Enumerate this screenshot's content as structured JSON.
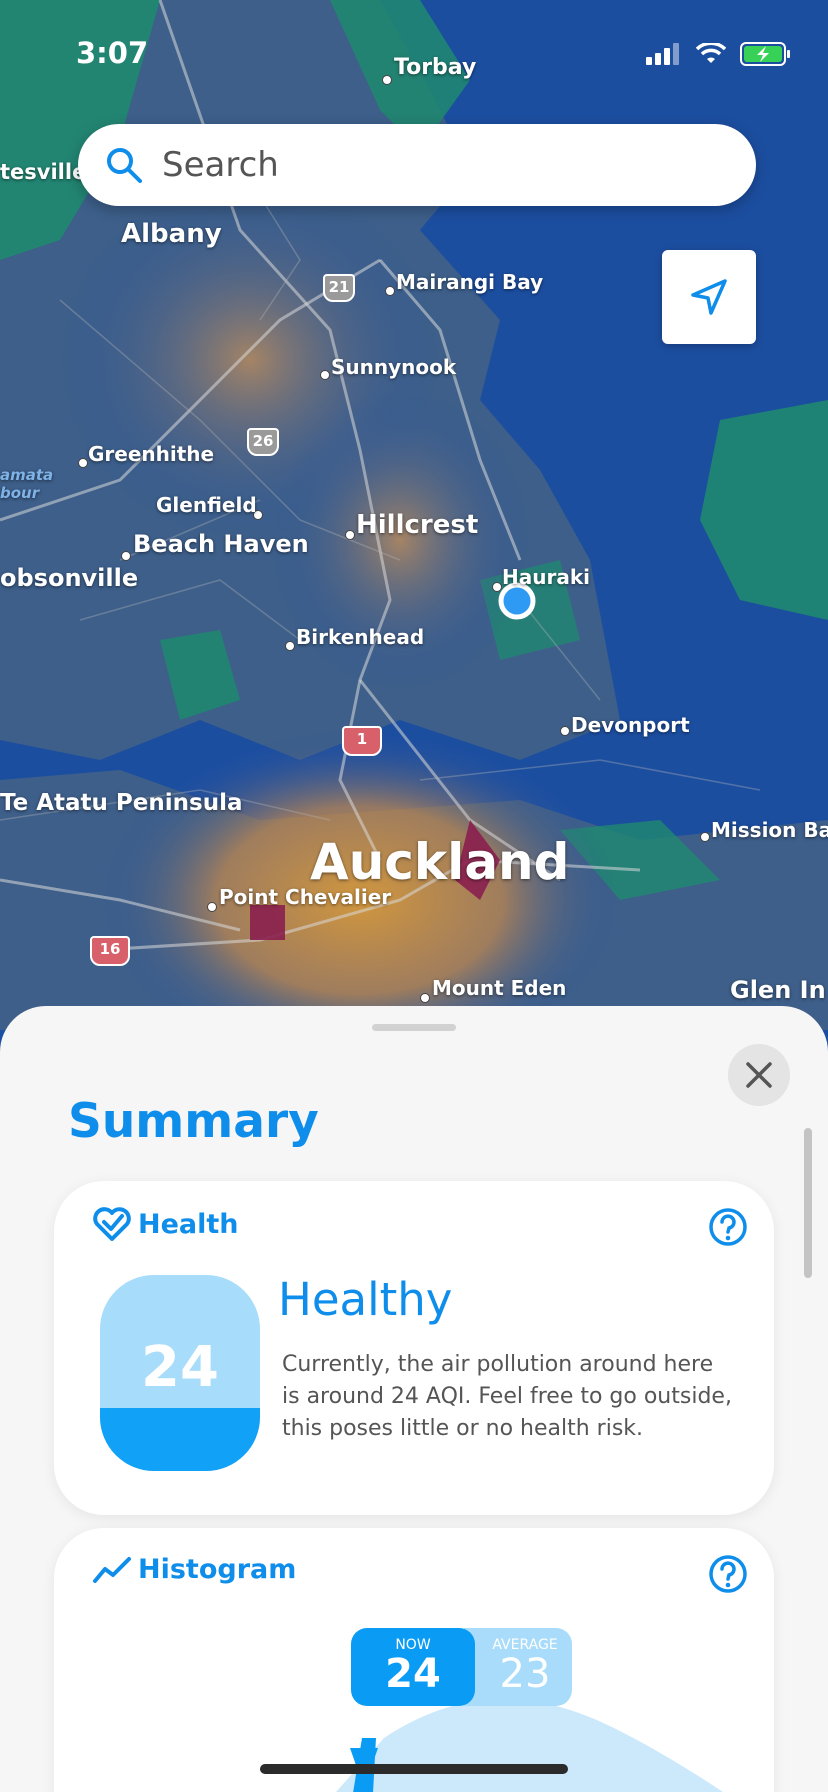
{
  "status_bar": {
    "time": "3:07"
  },
  "search": {
    "placeholder": "Search"
  },
  "map": {
    "places": {
      "torbay": "Torbay",
      "albany": "Albany",
      "tesville": "tesville",
      "mairangi_bay": "Mairangi Bay",
      "sunnynook": "Sunnynook",
      "greenhithe": "Greenhithe",
      "glenfield": "Glenfield",
      "hillcrest": "Hillcrest",
      "beach_haven": "Beach Haven",
      "hobsonville": "obsonville",
      "hauraki": "Hauraki",
      "birkenhead": "Birkenhead",
      "devonport": "Devonport",
      "te_atatu": "Te Atatu Peninsula",
      "mission_bay": "Mission Bay",
      "auckland": "Auckland",
      "point_chevalier": "Point Chevalier",
      "mount_eden": "Mount Eden",
      "glen_innes": "Glen In",
      "amata": "amata",
      "bour": "bour"
    },
    "routes": {
      "r21": "21",
      "r26": "26",
      "r1": "1",
      "r16": "16"
    }
  },
  "sheet": {
    "title": "Summary",
    "health": {
      "header": "Health",
      "aqi": "24",
      "level": 0.32,
      "status": "Healthy",
      "description": "Currently, the air pollution around here is around 24 AQI. Feel free to go outside, this poses little or no health risk."
    },
    "histogram": {
      "header": "Histogram",
      "now_label": "NOW",
      "now_value": "24",
      "average_label": "AVERAGE",
      "average_value": "23"
    }
  },
  "colors": {
    "accent": "#0e8eea",
    "aqi_fill": "#11a1f6",
    "aqi_bg": "#a7dcfb"
  }
}
